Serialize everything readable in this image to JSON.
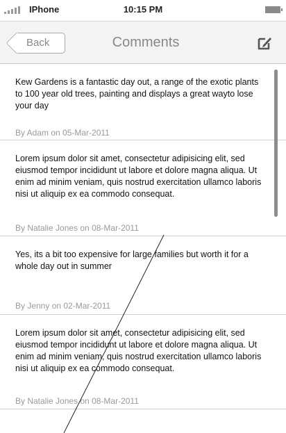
{
  "status_bar": {
    "carrier": "IPhone",
    "time": "10:15 PM"
  },
  "nav": {
    "back_label": "Back",
    "title": "Comments",
    "compose_icon": "compose-icon"
  },
  "comments": [
    {
      "text": "Kew Gardens is a fantastic day out, a range of the exotic plants to 100 year old trees, painting and displays a great wayto lose your day",
      "meta": "By Adam on 05-Mar-2011"
    },
    {
      "text": "Lorem ipsum dolor sit amet, consectetur adipisicing elit, sed eiusmod tempor incididunt ut labore et dolore magna aliqua. Ut enim ad minim veniam, quis nostrud exercitation ullamco laboris nisi ut aliquip ex ea commodo consequat.",
      "meta": "By Natalie Jones on 08-Mar-2011"
    },
    {
      "text": "Yes, its a bit too expensive for large families but worth it for a whole day out in summer",
      "meta": "By Jenny on 02-Mar-2011"
    },
    {
      "text": "Lorem ipsum dolor sit amet, consectetur adipisicing elit, sed eiusmod tempor incididunt ut labore et dolore magna aliqua. Ut enim ad minim veniam, quis nostrud exercitation ullamco laboris nisi ut aliquip ex ea commodo consequat.",
      "meta": "By Natalie Jones on 08-Mar-2011"
    }
  ]
}
